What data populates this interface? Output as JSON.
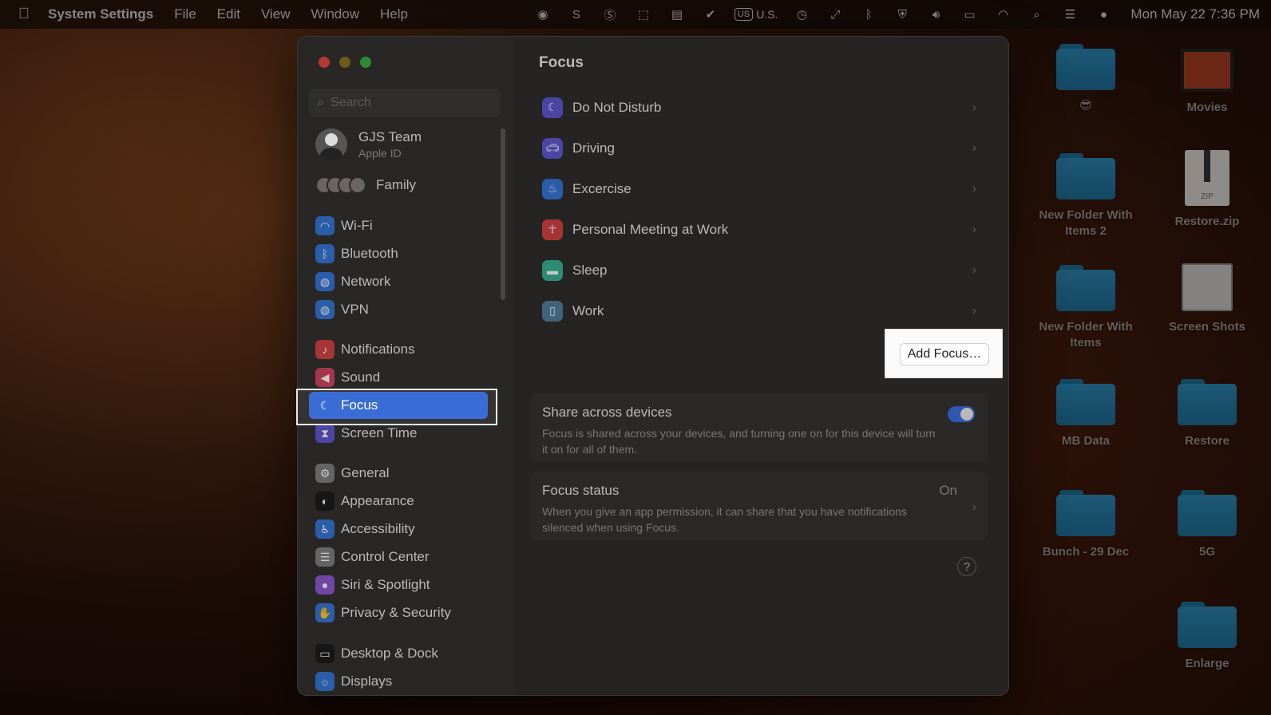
{
  "menubar": {
    "apple": "",
    "app_name": "System Settings",
    "menus": [
      "File",
      "Edit",
      "View",
      "Window",
      "Help"
    ],
    "input_source_badge": "US",
    "input_source_label": "U.S.",
    "clock": "Mon May 22  7:36 PM"
  },
  "desktop": {
    "items": [
      {
        "label": "😎",
        "kind": "folder"
      },
      {
        "label": "Movies",
        "kind": "movie"
      },
      {
        "label": "New Folder With Items 2",
        "kind": "folder"
      },
      {
        "label": "Restore.zip",
        "kind": "zip",
        "badge": "ZIP"
      },
      {
        "label": "New Folder With Items",
        "kind": "folder"
      },
      {
        "label": "Screen Shots",
        "kind": "screenshot"
      },
      {
        "label": "MB Data",
        "kind": "folder"
      },
      {
        "label": "Restore",
        "kind": "folder"
      },
      {
        "label": "Bunch - 29 Dec",
        "kind": "folder"
      },
      {
        "label": "5G",
        "kind": "folder"
      },
      {
        "label": "Enlarge",
        "kind": "folder"
      }
    ]
  },
  "sidebar": {
    "search_placeholder": "Search",
    "account": {
      "name": "GJS Team",
      "subtitle": "Apple ID"
    },
    "family_label": "Family",
    "items": [
      {
        "label": "Wi-Fi",
        "icon": "wifi-icon",
        "color": "#2b6fd6"
      },
      {
        "label": "Bluetooth",
        "icon": "bluetooth-icon",
        "color": "#2b6fd6"
      },
      {
        "label": "Network",
        "icon": "globe-icon",
        "color": "#2b6fd6"
      },
      {
        "label": "VPN",
        "icon": "vpn-globe-icon",
        "color": "#2b6fd6"
      },
      {
        "label": "Notifications",
        "icon": "bell-icon",
        "color": "#d13a3a"
      },
      {
        "label": "Sound",
        "icon": "speaker-icon",
        "color": "#d13a5a"
      },
      {
        "label": "Focus",
        "icon": "moon-icon",
        "color": "#5a4fcf"
      },
      {
        "label": "Screen Time",
        "icon": "hourglass-icon",
        "color": "#5a4fcf"
      },
      {
        "label": "General",
        "icon": "gear-icon",
        "color": "#7a7a7a"
      },
      {
        "label": "Appearance",
        "icon": "appearance-icon",
        "color": "#111111"
      },
      {
        "label": "Accessibility",
        "icon": "accessibility-icon",
        "color": "#2b6fd6"
      },
      {
        "label": "Control Center",
        "icon": "control-center-icon",
        "color": "#7a7a7a"
      },
      {
        "label": "Siri & Spotlight",
        "icon": "siri-icon",
        "color": "#8a4fcf"
      },
      {
        "label": "Privacy & Security",
        "icon": "hand-icon",
        "color": "#2b6fd6"
      },
      {
        "label": "Desktop & Dock",
        "icon": "dock-icon",
        "color": "#111111"
      },
      {
        "label": "Displays",
        "icon": "sun-icon",
        "color": "#2b6fd6"
      }
    ]
  },
  "main": {
    "title": "Focus",
    "focus_modes": [
      {
        "label": "Do Not Disturb",
        "icon": "moon-icon",
        "color": "#5a4fcf"
      },
      {
        "label": "Driving",
        "icon": "car-icon",
        "color": "#5a4fcf"
      },
      {
        "label": "Excercise",
        "icon": "flame-icon",
        "color": "#2b6fd6"
      },
      {
        "label": "Personal Meeting at Work",
        "icon": "person-icon",
        "color": "#d13a3a"
      },
      {
        "label": "Sleep",
        "icon": "bed-icon",
        "color": "#2fae8e"
      },
      {
        "label": "Work",
        "icon": "badge-icon",
        "color": "#4a7a9a"
      }
    ],
    "add_focus_label": "Add Focus…",
    "share": {
      "title": "Share across devices",
      "description": "Focus is shared across your devices, and turning one on for this device will turn it on for all of them.",
      "enabled": true
    },
    "status": {
      "title": "Focus status",
      "value": "On",
      "description": "When you give an app permission, it can share that you have notifications silenced when using Focus."
    },
    "help_label": "?"
  }
}
